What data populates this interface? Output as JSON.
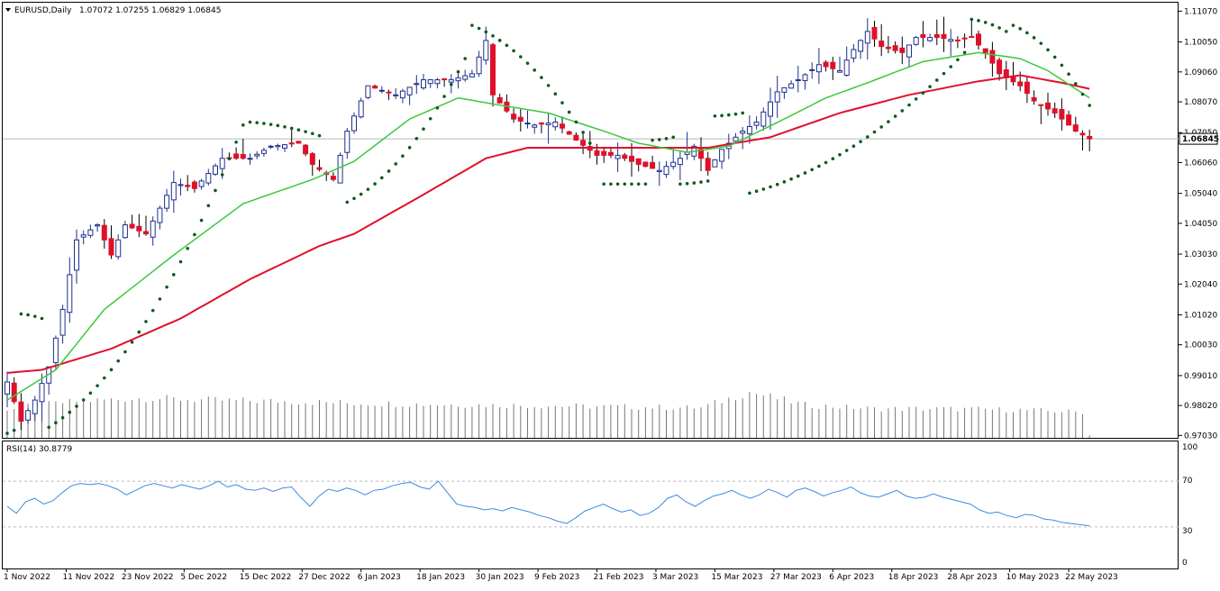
{
  "header": {
    "symbol_label": "EURUSD,Daily",
    "ohlc_label": "1.07072 1.07255 1.06829 1.06845"
  },
  "rsi_panel": {
    "label": "RSI(14) 30.8779",
    "levels": [
      70,
      30
    ],
    "scale_labels": [
      "100",
      "70",
      "30",
      "0"
    ]
  },
  "price_badge": "1.06845",
  "colors": {
    "bull_candle": "#1e2f8c",
    "bear_candle": "#e0102a",
    "ma_fast": "#3cc83c",
    "ma_slow": "#e0102a",
    "sar": "#0e5a1e",
    "rsi_line": "#3c8ae0",
    "volume": "#777777",
    "grid_level": "#bbbbbb",
    "current_price_line": "#b8b8b8"
  },
  "chart_data": [
    {
      "type": "candlestick",
      "title": "EURUSD,Daily",
      "price_axis_labels": [
        "1.11070",
        "1.10050",
        "1.09060",
        "1.08070",
        "1.07050",
        "1.06060",
        "1.05040",
        "1.04050",
        "1.03030",
        "1.02040",
        "1.01020",
        "1.00030",
        "0.99010",
        "0.98020",
        "0.97030"
      ],
      "ylim": [
        0.9695,
        1.1135
      ],
      "date_axis_labels": [
        "1 Nov 2022",
        "11 Nov 2022",
        "23 Nov 2022",
        "5 Dec 2022",
        "15 Dec 2022",
        "27 Dec 2022",
        "6 Jan 2023",
        "18 Jan 2023",
        "30 Jan 2023",
        "9 Feb 2023",
        "21 Feb 2023",
        "3 Mar 2023",
        "15 Mar 2023",
        "27 Mar 2023",
        "6 Apr 2023",
        "18 Apr 2023",
        "28 Apr 2023",
        "10 May 2023",
        "22 May 2023"
      ],
      "close_anchors": [
        [
          0,
          0.988
        ],
        [
          2,
          0.975
        ],
        [
          4,
          0.982
        ],
        [
          6,
          0.993
        ],
        [
          8,
          1.012
        ],
        [
          10,
          1.035
        ],
        [
          13,
          1.04
        ],
        [
          15,
          1.03
        ],
        [
          17,
          1.04
        ],
        [
          20,
          1.037
        ],
        [
          24,
          1.054
        ],
        [
          27,
          1.052
        ],
        [
          31,
          1.062
        ],
        [
          35,
          1.062
        ],
        [
          38,
          1.066
        ],
        [
          42,
          1.067
        ],
        [
          44,
          1.06
        ],
        [
          47,
          1.055
        ],
        [
          49,
          1.071
        ],
        [
          52,
          1.086
        ],
        [
          56,
          1.083
        ],
        [
          60,
          1.088
        ],
        [
          64,
          1.088
        ],
        [
          67,
          1.09
        ],
        [
          69,
          1.101
        ],
        [
          70,
          1.083
        ],
        [
          73,
          1.075
        ],
        [
          76,
          1.073
        ],
        [
          79,
          1.074
        ],
        [
          82,
          1.068
        ],
        [
          85,
          1.063
        ],
        [
          88,
          1.063
        ],
        [
          91,
          1.06
        ],
        [
          94,
          1.058
        ],
        [
          97,
          1.062
        ],
        [
          99,
          1.066
        ],
        [
          101,
          1.058
        ],
        [
          103,
          1.065
        ],
        [
          106,
          1.071
        ],
        [
          108,
          1.074
        ],
        [
          111,
          1.084
        ],
        [
          114,
          1.088
        ],
        [
          117,
          1.093
        ],
        [
          120,
          1.091
        ],
        [
          122,
          1.098
        ],
        [
          124,
          1.104
        ],
        [
          126,
          1.099
        ],
        [
          129,
          1.097
        ],
        [
          131,
          1.102
        ],
        [
          134,
          1.102
        ],
        [
          137,
          1.101
        ],
        [
          139,
          1.102
        ],
        [
          141,
          1.097
        ],
        [
          143,
          1.09
        ],
        [
          146,
          1.086
        ],
        [
          148,
          1.081
        ],
        [
          151,
          1.077
        ],
        [
          154,
          1.071
        ],
        [
          156,
          1.0685
        ]
      ],
      "last_close": 1.06845,
      "bars": 157,
      "series": [
        {
          "name": "",
          "kind": "moving-average-fast",
          "color": "#3cc83c",
          "anchors": [
            [
              0,
              0.982
            ],
            [
              7,
              0.992
            ],
            [
              14,
              1.012
            ],
            [
              24,
              1.03
            ],
            [
              34,
              1.047
            ],
            [
              44,
              1.055
            ],
            [
              50,
              1.061
            ],
            [
              58,
              1.075
            ],
            [
              65,
              1.082
            ],
            [
              70,
              1.08
            ],
            [
              78,
              1.077
            ],
            [
              86,
              1.071
            ],
            [
              91,
              1.067
            ],
            [
              98,
              1.064
            ],
            [
              104,
              1.066
            ],
            [
              112,
              1.075
            ],
            [
              118,
              1.082
            ],
            [
              124,
              1.087
            ],
            [
              132,
              1.094
            ],
            [
              140,
              1.097
            ],
            [
              146,
              1.095
            ],
            [
              150,
              1.091
            ],
            [
              156,
              1.082
            ]
          ]
        },
        {
          "name": "",
          "kind": "moving-average-slow",
          "color": "#e0102a",
          "anchors": [
            [
              0,
              0.991
            ],
            [
              5,
              0.992
            ],
            [
              15,
              0.999
            ],
            [
              25,
              1.009
            ],
            [
              35,
              1.022
            ],
            [
              45,
              1.033
            ],
            [
              50,
              1.037
            ],
            [
              60,
              1.05
            ],
            [
              69,
              1.062
            ],
            [
              75,
              1.0655
            ],
            [
              85,
              1.0655
            ],
            [
              95,
              1.0655
            ],
            [
              101,
              1.0655
            ],
            [
              110,
              1.069
            ],
            [
              120,
              1.077
            ],
            [
              130,
              1.083
            ],
            [
              140,
              1.0875
            ],
            [
              146,
              1.0895
            ],
            [
              152,
              1.087
            ],
            [
              156,
              1.085
            ]
          ]
        },
        {
          "name": "",
          "kind": "parabolic-sar",
          "segments": [
            {
              "from": 0,
              "to": 1,
              "side": "below",
              "start": 0.971,
              "end": 0.972
            },
            {
              "from": 2,
              "to": 5,
              "side": "above",
              "start": 1.0105,
              "end": 1.009
            },
            {
              "from": 6,
              "to": 34,
              "side": "below",
              "start": 0.973,
              "end": 1.073
            },
            {
              "from": 35,
              "to": 45,
              "side": "above",
              "start": 1.074,
              "end": 1.0695
            },
            {
              "from": 49,
              "to": 66,
              "side": "below",
              "start": 1.0475,
              "end": 1.095
            },
            {
              "from": 67,
              "to": 84,
              "side": "above",
              "start": 1.106,
              "end": 1.067
            },
            {
              "from": 86,
              "to": 92,
              "side": "below",
              "start": 1.0535,
              "end": 1.0535
            },
            {
              "from": 93,
              "to": 96,
              "side": "above",
              "start": 1.068,
              "end": 1.069
            },
            {
              "from": 97,
              "to": 101,
              "side": "below",
              "start": 1.0535,
              "end": 1.0545
            },
            {
              "from": 102,
              "to": 106,
              "side": "above",
              "start": 1.076,
              "end": 1.077
            },
            {
              "from": 107,
              "to": 138,
              "side": "below",
              "start": 1.0505,
              "end": 1.097
            },
            {
              "from": 139,
              "to": 144,
              "side": "above",
              "start": 1.108,
              "end": 1.104
            },
            {
              "from": 145,
              "to": 156,
              "side": "above",
              "start": 1.106,
              "end": 1.0795
            }
          ]
        },
        {
          "name": "",
          "kind": "volume",
          "anchors": [
            [
              0,
              0.62
            ],
            [
              10,
              0.78
            ],
            [
              20,
              0.85
            ],
            [
              30,
              0.8
            ],
            [
              40,
              0.78
            ],
            [
              50,
              0.74
            ],
            [
              60,
              0.72
            ],
            [
              70,
              0.7
            ],
            [
              80,
              0.68
            ],
            [
              90,
              0.66
            ],
            [
              100,
              0.64
            ],
            [
              107,
              0.98
            ],
            [
              115,
              0.7
            ],
            [
              125,
              0.62
            ],
            [
              135,
              0.62
            ],
            [
              145,
              0.6
            ],
            [
              155,
              0.55
            ],
            [
              156,
              0.05
            ]
          ]
        }
      ]
    },
    {
      "type": "line",
      "title": "RSI(14) 30.8779",
      "ylim": [
        0,
        100
      ],
      "series": [
        {
          "name": "",
          "values": [
            48,
            42,
            52,
            55,
            50,
            53,
            60,
            66,
            68,
            67,
            68,
            66,
            63,
            58,
            62,
            66,
            68,
            66,
            64,
            67,
            65,
            63,
            66,
            70,
            65,
            67,
            63,
            62,
            64,
            61,
            64,
            65,
            56,
            48,
            57,
            63,
            61,
            64,
            62,
            58,
            62,
            63,
            66,
            68,
            69,
            65,
            63,
            70,
            60,
            50,
            48,
            47,
            45,
            46,
            44,
            47,
            45,
            43,
            40,
            38,
            35,
            33,
            38,
            44,
            47,
            50,
            46,
            43,
            45,
            40,
            42,
            47,
            55,
            58,
            52,
            48,
            53,
            57,
            59,
            62,
            58,
            55,
            58,
            63,
            60,
            56,
            62,
            64,
            61,
            57,
            60,
            62,
            65,
            60,
            57,
            56,
            59,
            62,
            57,
            55,
            56,
            59,
            56,
            54,
            52,
            50,
            45,
            42,
            43,
            40,
            38,
            41,
            40,
            37,
            36,
            34,
            33,
            32,
            31
          ]
        }
      ],
      "levels": [
        30,
        70
      ]
    }
  ]
}
